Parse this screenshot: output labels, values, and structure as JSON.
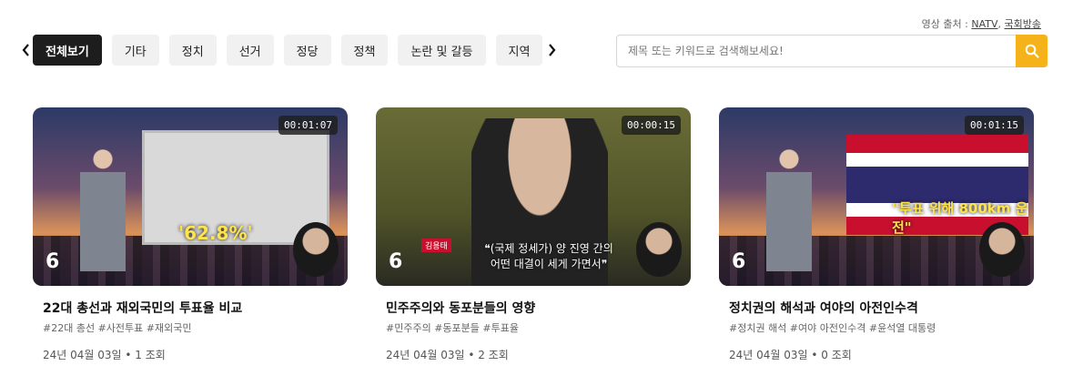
{
  "source": {
    "label": "영상 출처 :",
    "links": [
      "NATV",
      "국회방송"
    ],
    "sep": ","
  },
  "tabs": [
    "전체보기",
    "기타",
    "정치",
    "선거",
    "정당",
    "정책",
    "논란 및 갈등",
    "지역"
  ],
  "active_tab": 0,
  "search": {
    "placeholder": "제목 또는 키워드로 검색해보세요!"
  },
  "colors": {
    "accent": "#f5b21a",
    "active_chip": "#1d1d1d",
    "chip": "#f1f1f1"
  },
  "videos": [
    {
      "duration": "00:01:07",
      "title": "22대 총선과 재외국민의 투표율 비교",
      "tags": "#22대 총선  #사전투표  #재외국민",
      "meta": "24년 04월 03일 • 1 조회",
      "overlay_text": "'62.8%'"
    },
    {
      "duration": "00:00:15",
      "title": "민주주의와 동포분들의 영향",
      "tags": "#민주주의  #동포분들  #투표율",
      "meta": "24년 04월 03일 • 2 조회",
      "nametag": "김용태",
      "caption_line1": "❝(국제 정세가) 양 진영 간의",
      "caption_line2": "어떤 대결이 세게 가면서❞"
    },
    {
      "duration": "00:01:15",
      "title": "정치권의 해석과 여야의 아전인수격",
      "tags": "#정치권 해석  #여야 아전인수격  #윤석열 대통령",
      "meta": "24년 04월 03일 • 0 조회",
      "overlay_text": "\"투표 위해 800km 운전\""
    }
  ]
}
